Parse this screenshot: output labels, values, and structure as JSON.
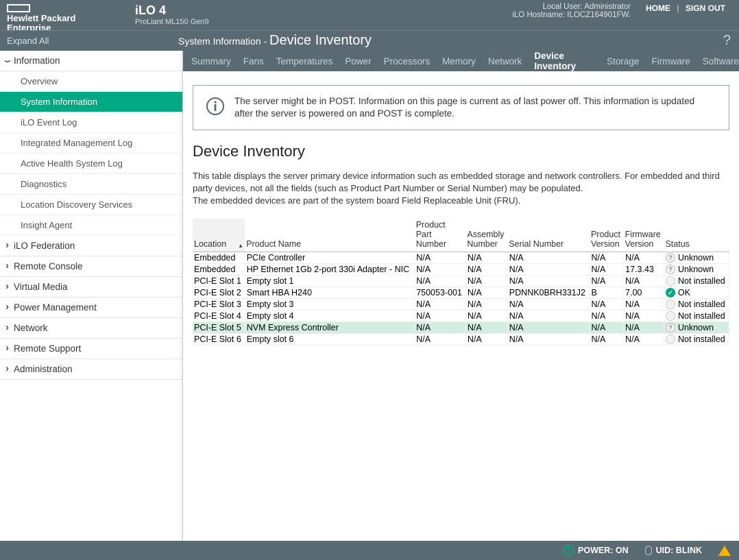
{
  "header": {
    "brand_line1": "Hewlett Packard",
    "brand_line2": "Enterprise",
    "product": "iLO 4",
    "model": "ProLiant ML150 Gen9",
    "user_label": "Local User: Administrator",
    "hostname_label": "iLO Hostname: ILOCZ164901FW.",
    "home": "HOME",
    "signout": "SIGN OUT",
    "expand_all": "Expand All",
    "page_title_prefix": "System Information - ",
    "page_title_main": "Device Inventory",
    "help_glyph": "?"
  },
  "sidebar": {
    "sections": [
      {
        "label": "Information",
        "expanded": true,
        "items": [
          {
            "label": "Overview",
            "active": false
          },
          {
            "label": "System Information",
            "active": true
          },
          {
            "label": "iLO Event Log",
            "active": false
          },
          {
            "label": "Integrated Management Log",
            "active": false
          },
          {
            "label": "Active Health System Log",
            "active": false
          },
          {
            "label": "Diagnostics",
            "active": false
          },
          {
            "label": "Location Discovery Services",
            "active": false
          },
          {
            "label": "Insight Agent",
            "active": false
          }
        ]
      },
      {
        "label": "iLO Federation",
        "expanded": false
      },
      {
        "label": "Remote Console",
        "expanded": false
      },
      {
        "label": "Virtual Media",
        "expanded": false
      },
      {
        "label": "Power Management",
        "expanded": false
      },
      {
        "label": "Network",
        "expanded": false
      },
      {
        "label": "Remote Support",
        "expanded": false
      },
      {
        "label": "Administration",
        "expanded": false
      }
    ]
  },
  "tabs": [
    {
      "label": "Summary",
      "active": false
    },
    {
      "label": "Fans",
      "active": false
    },
    {
      "label": "Temperatures",
      "active": false
    },
    {
      "label": "Power",
      "active": false
    },
    {
      "label": "Processors",
      "active": false
    },
    {
      "label": "Memory",
      "active": false
    },
    {
      "label": "Network",
      "active": false
    },
    {
      "label": "Device Inventory",
      "active": true
    },
    {
      "label": "Storage",
      "active": false
    },
    {
      "label": "Firmware",
      "active": false
    },
    {
      "label": "Software",
      "active": false
    }
  ],
  "info_banner": "The server might be in POST. Information on this page is current as of last power off. This information is updated after the server is powered on and POST is complete.",
  "section_title": "Device Inventory",
  "description": "This table displays the server primary device information such as embedded storage and network controllers. For embedded and third party devices, not all the fields (such as Product Part Number or Serial Number) may be populated.\nThe embedded devices are part of the system board Field Replaceable Unit (FRU).",
  "table": {
    "headers": [
      "Location",
      "Product Name",
      "Product Part Number",
      "Assembly Number",
      "Serial Number",
      "Product Version",
      "Firmware Version",
      "Status"
    ],
    "rows": [
      {
        "cells": [
          "Embedded",
          "PCIe Controller",
          "N/A",
          "N/A",
          "N/A",
          "N/A",
          "N/A"
        ],
        "status": {
          "text": "Unknown",
          "kind": "unknown"
        },
        "hl": false
      },
      {
        "cells": [
          "Embedded",
          "HP Ethernet 1Gb 2-port 330i Adapter - NIC",
          "N/A",
          "N/A",
          "N/A",
          "N/A",
          "17.3.43"
        ],
        "status": {
          "text": "Unknown",
          "kind": "unknown"
        },
        "hl": false
      },
      {
        "cells": [
          "PCI-E Slot 1",
          "Empty slot 1",
          "N/A",
          "N/A",
          "N/A",
          "N/A",
          "N/A"
        ],
        "status": {
          "text": "Not installed",
          "kind": "notinst"
        },
        "hl": false
      },
      {
        "cells": [
          "PCI-E Slot 2",
          "Smart HBA H240",
          "750053-001",
          "N/A",
          "PDNNK0BRH331J2",
          "B",
          "7.00"
        ],
        "status": {
          "text": "OK",
          "kind": "ok"
        },
        "hl": false
      },
      {
        "cells": [
          "PCI-E Slot 3",
          "Empty slot 3",
          "N/A",
          "N/A",
          "N/A",
          "N/A",
          "N/A"
        ],
        "status": {
          "text": "Not installed",
          "kind": "notinst"
        },
        "hl": false
      },
      {
        "cells": [
          "PCI-E Slot 4",
          "Empty slot 4",
          "N/A",
          "N/A",
          "N/A",
          "N/A",
          "N/A"
        ],
        "status": {
          "text": "Not installed",
          "kind": "notinst"
        },
        "hl": false
      },
      {
        "cells": [
          "PCI-E Slot 5",
          "NVM Express Controller",
          "N/A",
          "N/A",
          "N/A",
          "N/A",
          "N/A"
        ],
        "status": {
          "text": "Unknown",
          "kind": "unknown"
        },
        "hl": true
      },
      {
        "cells": [
          "PCI-E Slot 6",
          "Empty slot 6",
          "N/A",
          "N/A",
          "N/A",
          "N/A",
          "N/A"
        ],
        "status": {
          "text": "Not installed",
          "kind": "notinst"
        },
        "hl": false
      }
    ]
  },
  "footer": {
    "power": "POWER: ON",
    "uid": "UID: BLINK"
  }
}
